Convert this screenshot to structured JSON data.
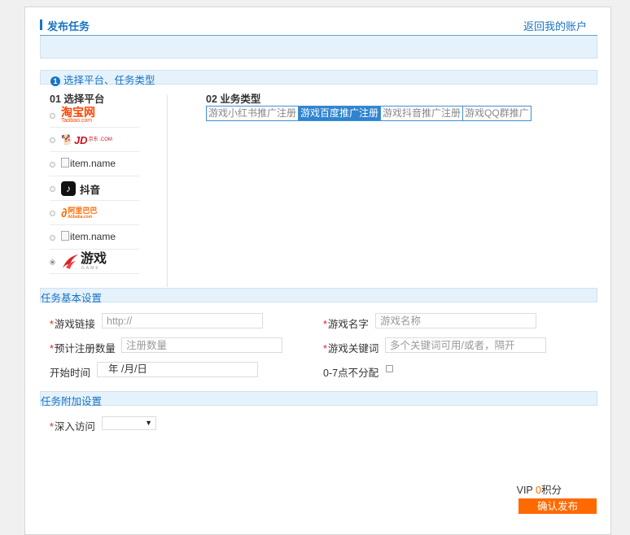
{
  "header": {
    "title": "发布任务",
    "back_link": "返回我的账户"
  },
  "section1": {
    "badge": "1",
    "title": "选择平台、任务类型",
    "platform_heading": "01 选择平台",
    "biz_heading": "02 业务类型",
    "platforms": [
      {
        "logo": "taobao-logo",
        "text": "淘宝网",
        "sub": "Taobao.com",
        "checked": false
      },
      {
        "logo": "jd-logo",
        "text": "JD",
        "sub": "京东 .COM",
        "checked": false
      },
      {
        "logo": "broken-image",
        "text": "item.name",
        "checked": false
      },
      {
        "logo": "douyin-logo",
        "icon": "♪",
        "text": "抖音",
        "checked": false
      },
      {
        "logo": "alibaba-logo",
        "text": "阿里巴巴",
        "sub": "Alibaba.com",
        "checked": false
      },
      {
        "logo": "broken-image",
        "text": "item.name",
        "checked": false
      },
      {
        "logo": "game-logo",
        "text": "游戏",
        "sub": "GAME",
        "checked": true
      }
    ],
    "biz_types": [
      {
        "label": "游戏小红书推广注册",
        "active": false
      },
      {
        "label": "游戏百度推广注册",
        "active": true
      },
      {
        "label": "游戏抖音推广注册",
        "active": false
      },
      {
        "label": "游戏QQ群推广",
        "active": false
      }
    ]
  },
  "section2": {
    "title": "任务基本设置",
    "game_link_label": "游戏链接",
    "game_link_placeholder": "http://",
    "game_name_label": "游戏名字",
    "game_name_placeholder": "游戏名称",
    "reg_count_label": "预计注册数量",
    "reg_count_placeholder": "注册数量",
    "keywords_label": "游戏关键词",
    "keywords_placeholder": "多个关键词可用/或者，隔开",
    "start_time_label": "开始时间",
    "start_time_value": "年 /月/日",
    "no_dispatch_label": "0-7点不分配"
  },
  "section3": {
    "title": "任务附加设置",
    "deep_visit_label": "深入访问",
    "deep_visit_value": ""
  },
  "footer": {
    "vip_prefix": "VIP ",
    "vip_points": "0",
    "vip_suffix": "积分",
    "submit_label": "确认发布"
  },
  "colors": {
    "accent": "#1a74c5",
    "active_tab": "#2f84cf",
    "submit": "#ff6a00",
    "required": "#e02020"
  }
}
